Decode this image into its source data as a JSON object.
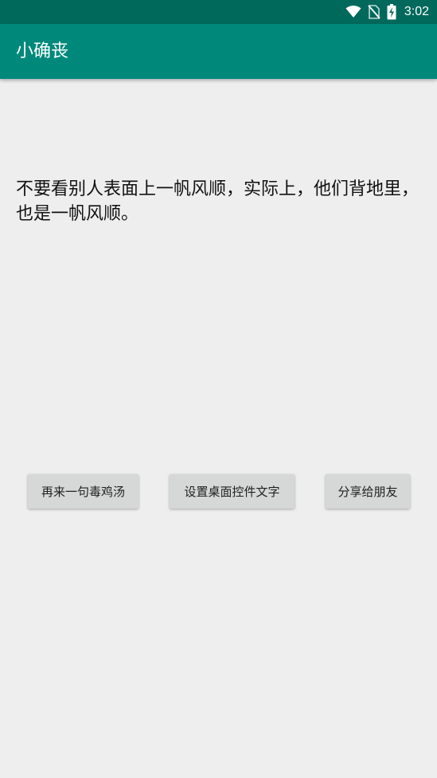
{
  "status_bar": {
    "time": "3:02",
    "icons": [
      "wifi-icon",
      "no-sim-icon",
      "battery-charging-icon"
    ]
  },
  "app_bar": {
    "title": "小确丧"
  },
  "main": {
    "quote": "不要看别人表面上一帆风顺，实际上，他们背地里，也是一帆风顺。"
  },
  "buttons": {
    "another": "再来一句毒鸡汤",
    "set_widget": "设置桌面控件文字",
    "share": "分享给朋友"
  },
  "colors": {
    "status_bar": "#00695c",
    "app_bar": "#00897b",
    "background": "#eeeeee",
    "button": "#d6d7d7"
  }
}
